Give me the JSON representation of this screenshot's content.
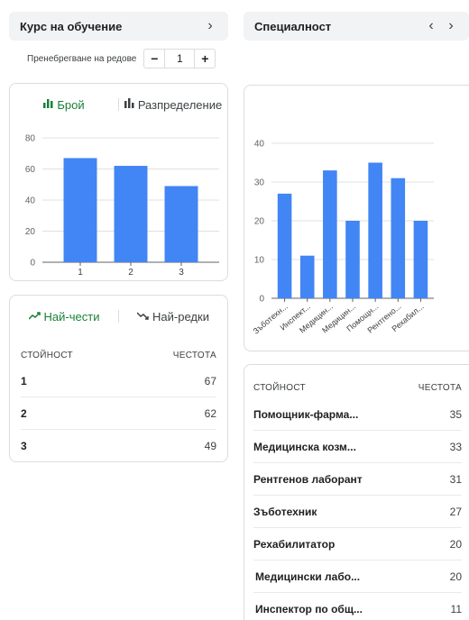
{
  "left": {
    "header": {
      "title": "Курс на обучение"
    },
    "skip": {
      "label": "Пренебрегване на редове",
      "minus": "−",
      "value": "1",
      "plus": "+"
    },
    "chart_card": {
      "tabs": [
        {
          "label": "Брой",
          "icon": "bar-chart-icon"
        },
        {
          "label": "Разпределение",
          "icon": "distribution-icon"
        }
      ]
    },
    "table_card": {
      "tabs": [
        {
          "label": "Най-чести",
          "icon": "trending-up-icon"
        },
        {
          "label": "Най-редки",
          "icon": "trending-down-icon"
        }
      ],
      "col_value": "СТОЙНОСТ",
      "col_freq": "ЧЕСТОТА",
      "rows": [
        {
          "value": "1",
          "count": "67"
        },
        {
          "value": "2",
          "count": "62"
        },
        {
          "value": "3",
          "count": "49"
        }
      ]
    }
  },
  "right": {
    "header": {
      "title": "Специалност"
    },
    "table_card": {
      "col_value": "СТОЙНОСТ",
      "col_freq": "ЧЕСТОТА",
      "rows": [
        {
          "value": "Помощник-фарма...",
          "count": "35"
        },
        {
          "value": "Медицинска козм...",
          "count": "33"
        },
        {
          "value": "Рентгенов лаборант",
          "count": "31"
        },
        {
          "value": "Зъботехник",
          "count": "27"
        },
        {
          "value": "Рехабилитатор",
          "count": "20"
        },
        {
          "value": "Медицински лабо...",
          "count": "20"
        },
        {
          "value": "Инспектор по общ...",
          "count": "11"
        }
      ]
    }
  },
  "colors": {
    "bar": "#4285f4",
    "active_tab": "#188038",
    "grid": "#e0e0e0",
    "axis": "#5f6368"
  },
  "chart_data": [
    {
      "type": "bar",
      "categories": [
        "1",
        "2",
        "3"
      ],
      "values": [
        67,
        62,
        49
      ],
      "yticks": [
        0,
        20,
        40,
        60,
        80
      ],
      "ylim": [
        0,
        80
      ]
    },
    {
      "type": "bar",
      "categories": [
        "Зъботехн...",
        "Инспект...",
        "Медицин...",
        "Медицин...",
        "Помощн...",
        "Рентгено...",
        "Рехабил..."
      ],
      "values": [
        27,
        11,
        33,
        20,
        35,
        31,
        20
      ],
      "yticks": [
        0,
        10,
        20,
        30,
        40
      ],
      "ylim": [
        0,
        40
      ]
    }
  ]
}
